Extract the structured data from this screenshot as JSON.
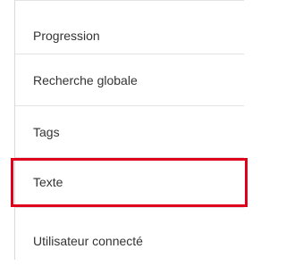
{
  "menu": {
    "items": [
      {
        "label": "Progression"
      },
      {
        "label": "Recherche globale"
      },
      {
        "label": "Tags"
      },
      {
        "label": "Texte",
        "highlighted": true
      },
      {
        "label": "Utilisateur connecté"
      }
    ]
  },
  "colors": {
    "highlight_border": "#e0001b",
    "divider": "#e3e3e3",
    "text": "#333333"
  }
}
